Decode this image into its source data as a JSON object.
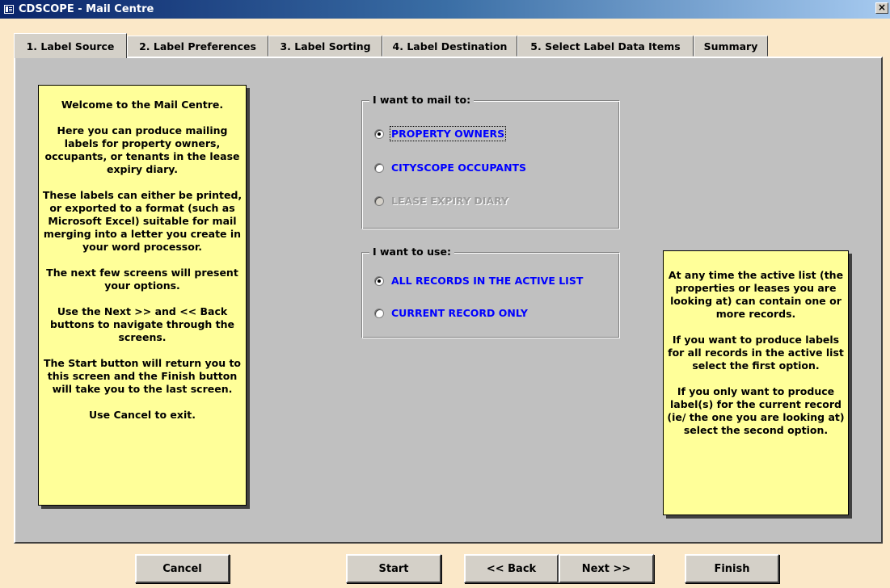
{
  "window": {
    "title": "CDSCOPE - Mail Centre",
    "icon": "form-icon",
    "close_glyph": "×"
  },
  "tabs": [
    {
      "label": "1. Label Source",
      "active": true
    },
    {
      "label": "2. Label Preferences",
      "active": false
    },
    {
      "label": "3. Label Sorting",
      "active": false
    },
    {
      "label": "4. Label Destination",
      "active": false
    },
    {
      "label": "5. Select Label Data Items",
      "active": false
    },
    {
      "label": "Summary",
      "active": false
    }
  ],
  "welcome_note": {
    "paragraphs": [
      "Welcome to the Mail Centre.",
      "Here you can produce mailing labels for property owners, occupants, or tenants in the lease expiry diary.",
      "These labels can either be printed, or exported to a format (such as Microsoft Excel) suitable for mail merging into a letter you create in your word processor.",
      "The next few screens will present your options.",
      "Use the Next >> and << Back buttons to navigate through the screens.",
      "The Start button will return you to this screen and the Finish button will take you to the last screen.",
      "Use Cancel to exit."
    ]
  },
  "mail_to": {
    "legend": "I want to mail to:",
    "options": [
      {
        "label": "PROPERTY OWNERS",
        "selected": true,
        "enabled": true
      },
      {
        "label": "CITYSCOPE OCCUPANTS",
        "selected": false,
        "enabled": true
      },
      {
        "label": "LEASE EXPIRY DIARY",
        "selected": false,
        "enabled": false
      }
    ]
  },
  "use": {
    "legend": "I want to use:",
    "options": [
      {
        "label": "ALL RECORDS IN THE ACTIVE LIST",
        "selected": true,
        "enabled": true
      },
      {
        "label": "CURRENT RECORD ONLY",
        "selected": false,
        "enabled": true
      }
    ]
  },
  "help_note": {
    "paragraphs": [
      "At any time the active list (the properties or leases you are looking at) can contain one or more records.",
      "If you want to produce labels for all records in the active list select the first option.",
      "If you only want to produce label(s) for the current record (ie/ the one you are looking at) select the second option."
    ]
  },
  "buttons": {
    "cancel": "Cancel",
    "start": "Start",
    "back": "<< Back",
    "next": "Next >>",
    "finish": "Finish"
  },
  "colors": {
    "window_bg": "#fbe8c8",
    "panel_bg": "#c0c0c0",
    "note_bg": "#ffff99",
    "option_text": "#0000ff",
    "disabled_text": "#9c9c9c",
    "titlebar_start": "#0a246a",
    "titlebar_end": "#a6caf0"
  }
}
